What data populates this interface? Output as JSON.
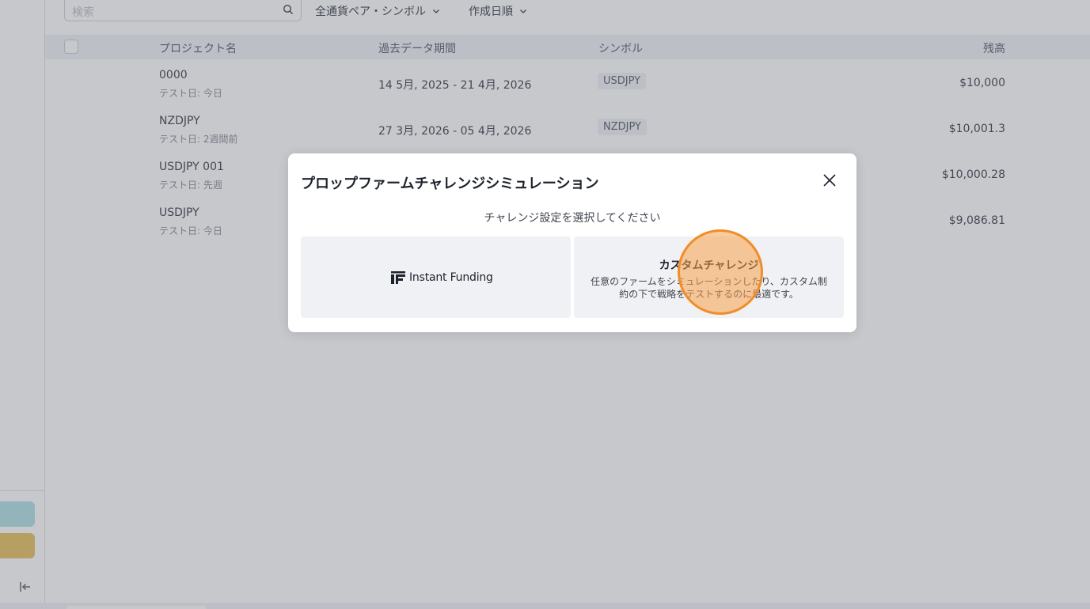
{
  "search": {
    "placeholder": "検索"
  },
  "filters": {
    "currency_pair": "全通貨ペア・シンボル",
    "sort": "作成日順"
  },
  "table": {
    "headers": {
      "name": "プロジェクト名",
      "period": "過去データ期間",
      "symbol": "シンボル",
      "balance": "残高"
    },
    "rows": [
      {
        "name": "0000",
        "test": "テスト日: 今日",
        "period": "14 5月, 2025 - 21 4月, 2026",
        "symbol": "USDJPY",
        "balance": "$10,000"
      },
      {
        "name": "NZDJPY",
        "test": "テスト日: 2週間前",
        "period": "27 3月, 2026 - 05 4月, 2026",
        "symbol": "NZDJPY",
        "balance": "$10,001.3"
      },
      {
        "name": "USDJPY 001",
        "test": "テスト日: 先週",
        "period": "",
        "symbol": "",
        "balance": "$10,000.28"
      },
      {
        "name": "USDJPY",
        "test": "テスト日: 今日",
        "period": "",
        "symbol": "",
        "balance": "$9,086.81"
      }
    ]
  },
  "modal": {
    "title": "プロップファームチャレンジシミュレーション",
    "subtitle": "チャレンジ設定を選択してください",
    "instant_funding": "Instant Funding",
    "custom_title": "カスタムチャレンジ",
    "custom_desc": "任意のファームをシミュレーションしたり、カスタム制約の下で戦略をテストするのに最適です。"
  },
  "colors": {
    "accent_teal": "#a6dde0",
    "accent_gold": "#e6b74a",
    "click_highlight": "#f28c28"
  },
  "icons": {
    "search": "search-icon",
    "chevron": "chevron-down-icon",
    "close": "close-icon",
    "collapse": "collapse-sidebar-icon"
  }
}
